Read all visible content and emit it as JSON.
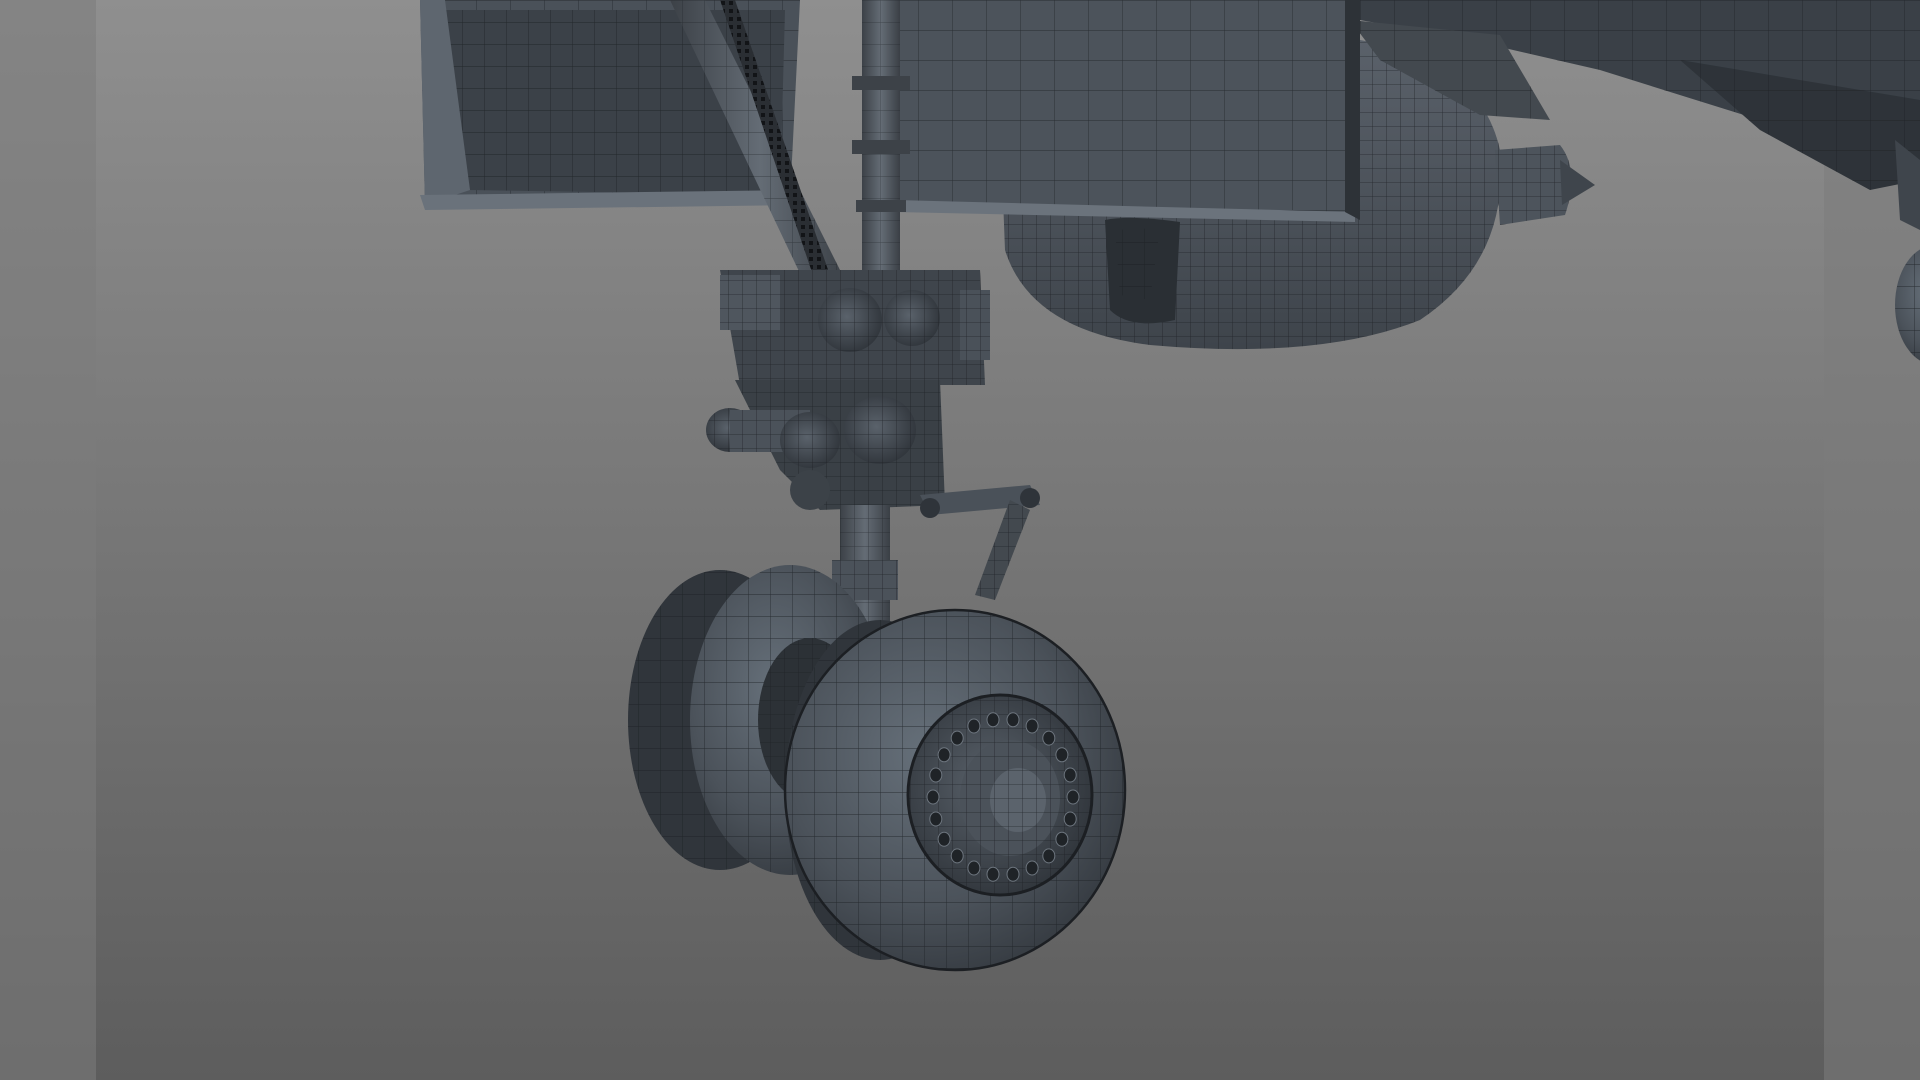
{
  "scene": {
    "subject": "aircraft-main-landing-gear-wireframe",
    "render_mode": "wireframe-on-shaded",
    "colors": {
      "background_top": "#8f8f8f",
      "background_bottom": "#5e5e5e",
      "side_band": "#7a7a7a",
      "model_fill": "#4a5058",
      "model_fill_dark": "#363b42",
      "model_fill_light": "#5c636c",
      "wire": "#1c1f23",
      "edge_highlight": "#7b838c"
    },
    "wheels": [
      {
        "name": "rear-wheel",
        "visible": true
      },
      {
        "name": "front-wheel",
        "visible": true
      }
    ],
    "components": [
      "wing-flap-fairing",
      "engine-nacelle",
      "fuselage-section",
      "shock-strut",
      "side-brace",
      "torque-link",
      "actuator-cylinders",
      "retraction-chain",
      "partial-wheel-right-edge"
    ]
  }
}
